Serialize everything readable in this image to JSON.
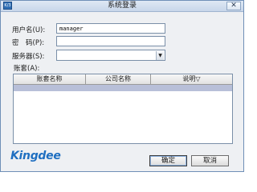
{
  "window": {
    "title": "系统登录",
    "icon": "app-icon",
    "icon_text": "K/3",
    "close_symbol": "✕"
  },
  "form": {
    "username_label": "用户名(U):",
    "username_value": "manager",
    "password_label": "密　码(P):",
    "password_value": "",
    "server_label": "服务器(S):",
    "server_value": "",
    "dropdown_symbol": "▼",
    "account_label": "账套(A):"
  },
  "grid": {
    "columns": [
      "账套名称",
      "公司名称",
      "说明▽"
    ],
    "selected_row": {
      "name": "",
      "company": "",
      "note": ""
    }
  },
  "footer": {
    "logo_text": "Kingdee",
    "ok_label": "确定",
    "cancel_label": "取消"
  },
  "colors": {
    "brand": "#1f6fc1",
    "selection": "#b8bfd8",
    "titlebar": "#c7d6ea"
  }
}
